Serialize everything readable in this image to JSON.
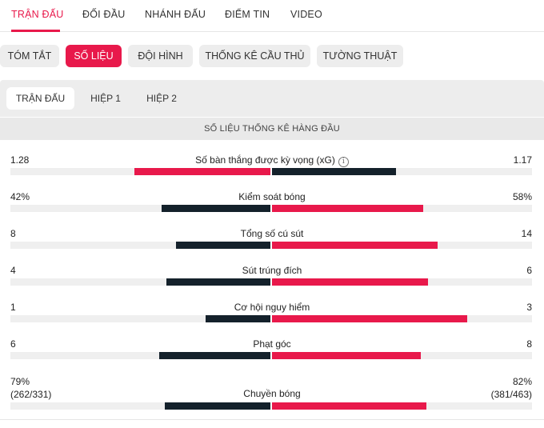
{
  "colors": {
    "accent": "#e8194b",
    "dark": "#14212b",
    "track": "#efefef"
  },
  "top_tabs": [
    {
      "label": "TRẬN ĐẤU",
      "active": true
    },
    {
      "label": "ĐỐI ĐẦU",
      "active": false
    },
    {
      "label": "NHÁNH ĐẤU",
      "active": false
    },
    {
      "label": "ĐIỂM TIN",
      "active": false
    },
    {
      "label": "VIDEO",
      "active": false
    }
  ],
  "pills": [
    {
      "label": "TÓM TẮT",
      "active": false
    },
    {
      "label": "SỐ LIỆU",
      "active": true
    },
    {
      "label": "ĐỘI HÌNH",
      "active": false
    },
    {
      "label": "THỐNG KÊ CẦU THỦ",
      "active": false
    },
    {
      "label": "TƯỜNG THUẬT",
      "active": false
    }
  ],
  "sub_tabs": [
    {
      "label": "TRẬN ĐẤU",
      "active": true
    },
    {
      "label": "HIỆP 1",
      "active": false
    },
    {
      "label": "HIỆP 2",
      "active": false
    }
  ],
  "section_title": "SỐ LIỆU THỐNG KÊ HÀNG ĐẦU",
  "stats": [
    {
      "name": "Số bàn thắng được kỳ vọng (xG)",
      "left": "1.28",
      "right": "1.17",
      "left_value": 1.28,
      "right_value": 1.17,
      "left_color": "#e8194b",
      "right_color": "#14212b",
      "has_info": true
    },
    {
      "name": "Kiểm soát bóng",
      "left": "42%",
      "right": "58%",
      "left_value": 42,
      "right_value": 58,
      "left_color": "#14212b",
      "right_color": "#e8194b"
    },
    {
      "name": "Tổng số cú sút",
      "left": "8",
      "right": "14",
      "left_value": 8,
      "right_value": 14,
      "left_color": "#14212b",
      "right_color": "#e8194b"
    },
    {
      "name": "Sút trúng đích",
      "left": "4",
      "right": "6",
      "left_value": 4,
      "right_value": 6,
      "left_color": "#14212b",
      "right_color": "#e8194b"
    },
    {
      "name": "Cơ hội nguy hiểm",
      "left": "1",
      "right": "3",
      "left_value": 1,
      "right_value": 3,
      "left_color": "#14212b",
      "right_color": "#e8194b"
    },
    {
      "name": "Phạt góc",
      "left": "6",
      "right": "8",
      "left_value": 6,
      "right_value": 8,
      "left_color": "#14212b",
      "right_color": "#e8194b"
    },
    {
      "name": "Chuyền bóng",
      "left": "79%",
      "right": "82%",
      "left_sub": "(262/331)",
      "right_sub": "(381/463)",
      "left_value": 262,
      "right_value": 381,
      "left_color": "#14212b",
      "right_color": "#e8194b"
    }
  ],
  "info_icon": "info-circle-icon"
}
